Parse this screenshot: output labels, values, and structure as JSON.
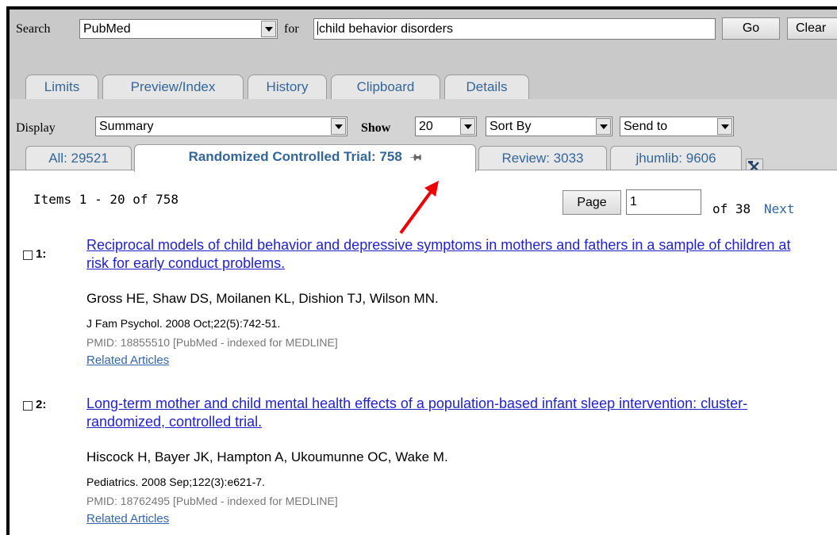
{
  "search": {
    "label": "Search",
    "database": "PubMed",
    "for_label": "for",
    "query": "child behavior disorders",
    "go_label": "Go",
    "clear_label": "Clear"
  },
  "nav_tabs": [
    "Limits",
    "Preview/Index",
    "History",
    "Clipboard",
    "Details"
  ],
  "display_bar": {
    "display_label": "Display",
    "display_value": "Summary",
    "show_label": "Show",
    "show_value": "20",
    "sort_value": "Sort By",
    "send_value": "Send to"
  },
  "filter_tabs": [
    {
      "label": "All: 29521"
    },
    {
      "label": "Randomized Controlled Trial: 758",
      "pin": "♐",
      "active": true
    },
    {
      "label": "Review: 3033"
    },
    {
      "label": "jhumlib: 9606"
    }
  ],
  "tool_icon": "hammer-wrench-icon",
  "pagination": {
    "items_text": "Items 1 - 20 of 758",
    "page_button": "Page",
    "page_value": "1",
    "of_text": "of 38",
    "next_label": "Next"
  },
  "annotation": {
    "arrow_color": "#ee0000"
  },
  "results": [
    {
      "number": "1:",
      "title": "Reciprocal models of child behavior and depressive symptoms in mothers and fathers in a sample of children at risk for early conduct problems.",
      "authors": "Gross HE, Shaw DS, Moilanen KL, Dishion TJ, Wilson MN.",
      "journal": "J Fam Psychol. 2008 Oct;22(5):742-51.",
      "pmid": "PMID: 18855510 [PubMed - indexed for MEDLINE]",
      "related": "Related Articles"
    },
    {
      "number": "2:",
      "title": "Long-term mother and child mental health effects of a population-based infant sleep intervention: cluster-randomized, controlled trial.",
      "authors": "Hiscock H, Bayer JK, Hampton A, Ukoumunne OC, Wake M.",
      "journal": "Pediatrics. 2008 Sep;122(3):e621-7.",
      "pmid": "PMID: 18762495 [PubMed - indexed for MEDLINE]",
      "related": "Related Articles"
    }
  ]
}
